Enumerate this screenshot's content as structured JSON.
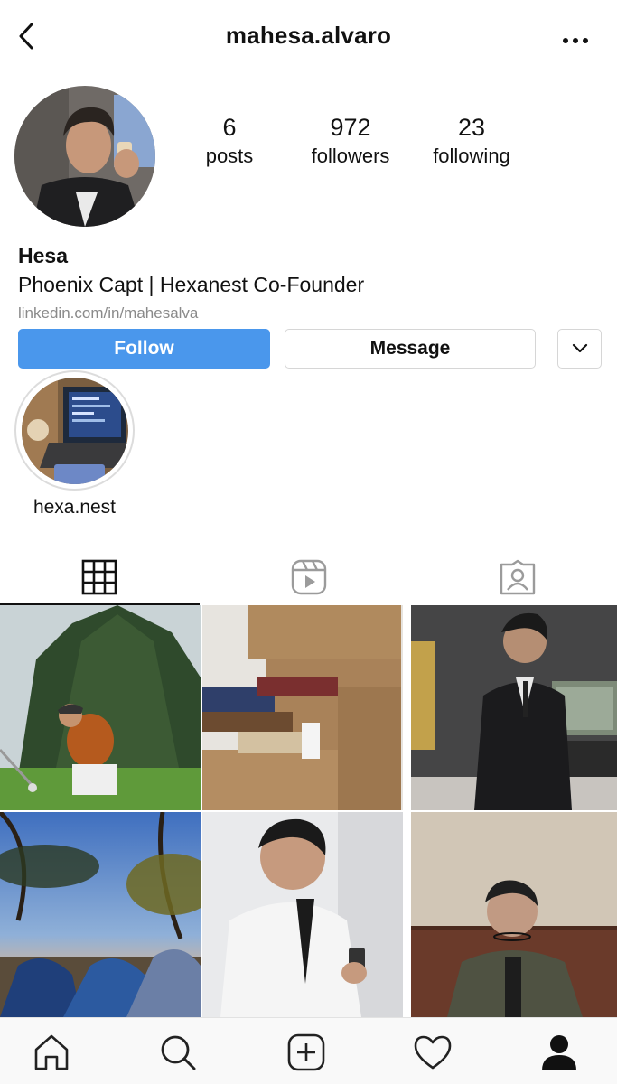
{
  "header": {
    "username": "mahesa.alvaro",
    "back_icon": "chevron-left-icon",
    "more_icon": "more-horizontal-icon"
  },
  "profile": {
    "avatar_icon": "profile-photo",
    "stats": {
      "posts": {
        "value": "6",
        "label": "posts"
      },
      "followers": {
        "value": "972",
        "label": "followers"
      },
      "following": {
        "value": "23",
        "label": "following"
      }
    },
    "name": "Hesa",
    "bio": "Phoenix Capt | Hexanest Co-Founder",
    "link": "linkedin.com/in/mahesalva"
  },
  "actions": {
    "follow_label": "Follow",
    "message_label": "Message",
    "dropdown_icon": "chevron-down-icon",
    "follow_color": "#4a97ec"
  },
  "highlights": [
    {
      "label": "hexa.nest"
    }
  ],
  "tabs": [
    {
      "name": "grid",
      "icon": "grid-icon",
      "active": true
    },
    {
      "name": "reels",
      "icon": "reels-icon",
      "active": false
    },
    {
      "name": "tagged",
      "icon": "tagged-icon",
      "active": false
    }
  ],
  "posts": [
    {
      "subject": "golf swing outdoors"
    },
    {
      "subject": "boxes of books"
    },
    {
      "subject": "man in suit at watch display"
    },
    {
      "subject": "camping tents at sunset"
    },
    {
      "subject": "man in white shirt with phone"
    },
    {
      "subject": "man leaning on wall"
    }
  ],
  "bottom_nav": [
    {
      "name": "home",
      "icon": "home-icon"
    },
    {
      "name": "search",
      "icon": "search-icon"
    },
    {
      "name": "new-post",
      "icon": "add-square-icon"
    },
    {
      "name": "activity",
      "icon": "heart-icon"
    },
    {
      "name": "profile",
      "icon": "user-icon"
    }
  ]
}
